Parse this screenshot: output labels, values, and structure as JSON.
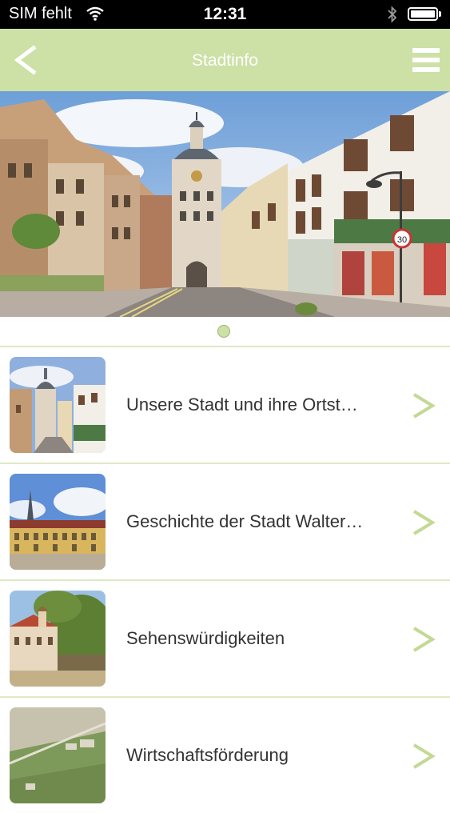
{
  "status_bar": {
    "carrier": "SIM fehlt",
    "time": "12:31"
  },
  "nav": {
    "title": "Stadtinfo",
    "back_icon": "chevron-left-icon",
    "menu_icon": "hamburger-menu-icon"
  },
  "hero": {
    "sign_speed": "30",
    "page_count": 1,
    "current_page": 1
  },
  "list": {
    "items": [
      {
        "label": "Unsere Stadt und ihre Ortst…",
        "icon": "chevron-right-icon"
      },
      {
        "label": "Geschichte der Stadt Walter…",
        "icon": "chevron-right-icon"
      },
      {
        "label": "Sehenswürdigkeiten",
        "icon": "chevron-right-icon"
      },
      {
        "label": "Wirtschaftsförderung",
        "icon": "chevron-right-icon"
      }
    ]
  },
  "colors": {
    "accent": "#cde0a6",
    "chevron": "#c3d994",
    "divider": "#dfe9c6"
  }
}
